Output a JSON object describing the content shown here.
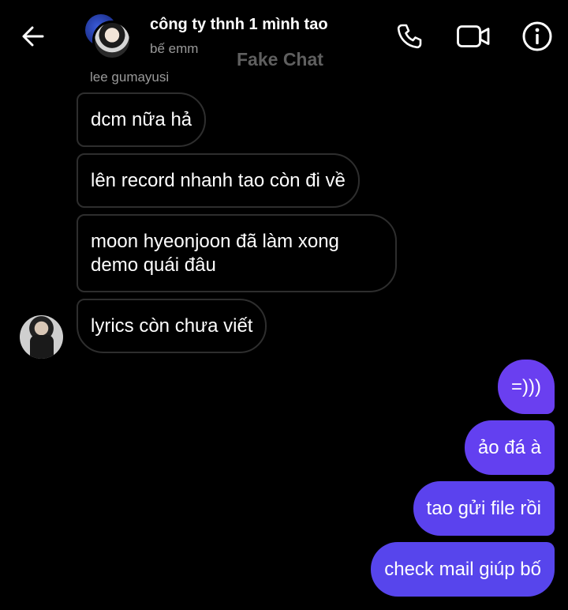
{
  "header": {
    "title": "công ty thnh 1 mình tao",
    "status": "bế emm",
    "watermark": "Fake Chat",
    "icons": {
      "back": "arrow-left-icon",
      "call": "phone-icon",
      "video": "video-camera-icon",
      "info": "info-icon"
    }
  },
  "conversation": {
    "sender_name": "lee gumayusi",
    "incoming": [
      {
        "text": "dcm nữa hả"
      },
      {
        "text": "lên record nhanh tao còn đi về"
      },
      {
        "text": "moon hyeonjoon đã làm xong demo quái đâu"
      },
      {
        "text": "lyrics còn chưa viết"
      }
    ],
    "outgoing": [
      {
        "text": "=)))"
      },
      {
        "text": "ảo đá à"
      },
      {
        "text": "tao gửi file rồi"
      },
      {
        "text": "check mail giúp bố"
      }
    ]
  },
  "colors": {
    "background": "#000000",
    "outgoing_bubble": "#6a3ff0",
    "incoming_border": "#2e2e2e",
    "muted_text": "#9a9a9a"
  }
}
